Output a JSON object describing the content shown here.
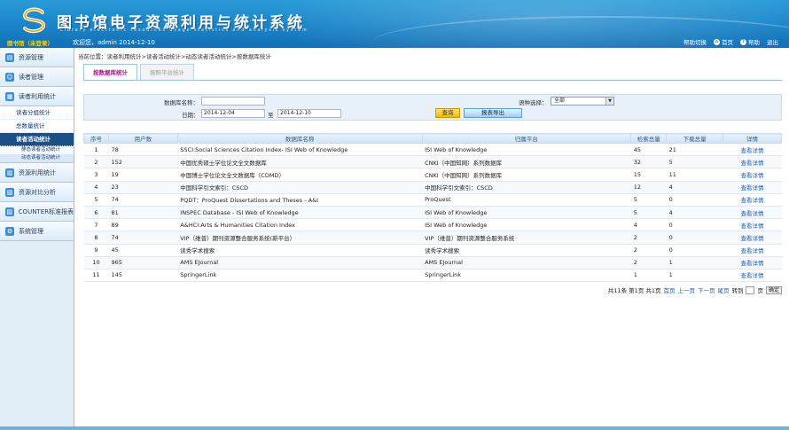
{
  "header": {
    "title": "图书馆电子资源利用与统计系统",
    "subtitle": "Library electronic resources usage statistics and analysis system",
    "user_role": "图书馆（未登录）",
    "welcome": "欢迎您，admin  2014-12-10",
    "links": {
      "switch": "帮助切换",
      "home": "首页",
      "help": "帮助",
      "logout": "退出"
    }
  },
  "sidebar": {
    "items": [
      {
        "label": "资源管理"
      },
      {
        "label": "读者管理"
      },
      {
        "label": "读者利用统计"
      },
      {
        "label": "资源利用统计"
      },
      {
        "label": "资源对比分析"
      },
      {
        "label": "COUNTER标准报表"
      },
      {
        "label": "系统管理"
      }
    ],
    "sub_items": [
      {
        "label": "读者分组统计"
      },
      {
        "label": "总数量统计"
      },
      {
        "label": "读者活动统计"
      }
    ],
    "subsub_items": [
      {
        "label": "静态读者活动统计"
      },
      {
        "label": "动态读者活动统计"
      }
    ]
  },
  "breadcrumb": "当前位置：读者利用统计>读者活动统计>动态读者活动统计>按数据库统计",
  "tabs": [
    {
      "label": "按数据库统计"
    },
    {
      "label": "按照平台统计"
    }
  ],
  "search": {
    "db_name_label": "数据库名称：",
    "db_name_value": "",
    "date_label": "日期：",
    "date_from": "2014-12-04",
    "date_to_label": "至",
    "date_to": "2014-12-10",
    "lang_label": "语种选择：",
    "lang_value": "全部",
    "query_button": "查询",
    "export_button": "报表导出"
  },
  "table": {
    "headers": [
      "序号",
      "用户数",
      "数据库名称",
      "归属平台",
      "检索总量",
      "下载总量",
      "详情"
    ],
    "rows": [
      [
        "1",
        "78",
        "SSCI:Social Sciences Citation Index- ISI Web of Knowledge",
        "ISI Web of Knowledge",
        "45",
        "21",
        "查看详情"
      ],
      [
        "2",
        "152",
        "中国优秀硕士学位论文全文数据库",
        "CNKI（中国知网）系列数据库",
        "32",
        "5",
        "查看详情"
      ],
      [
        "3",
        "19",
        "中国博士学位论文全文数据库（CDMD）",
        "CNKI（中国知网）系列数据库",
        "15",
        "11",
        "查看详情"
      ],
      [
        "4",
        "23",
        "中国科学引文索引：CSCD",
        "中国科学引文索引：CSCD",
        "12",
        "4",
        "查看详情"
      ],
      [
        "5",
        "74",
        "PQDT：ProQuest Dissertations and Theses - A&I",
        "ProQuest",
        "5",
        "0",
        "查看详情"
      ],
      [
        "6",
        "81",
        "INSPEC Database - ISI Web of Knowledge",
        "ISI Web of Knowledge",
        "5",
        "4",
        "查看详情"
      ],
      [
        "7",
        "89",
        "A&HCI:Arts & Humanities Citation Index",
        "ISI Web of Knowledge",
        "4",
        "0",
        "查看详情"
      ],
      [
        "8",
        "74",
        "VIP（维普）期刊资源整合服务系统(新平台）",
        "VIP（维普）期刊资源整合服务系统",
        "2",
        "0",
        "查看详情"
      ],
      [
        "9",
        "45",
        "读秀学术搜索",
        "读秀学术搜索",
        "2",
        "0",
        "查看详情"
      ],
      [
        "10",
        "965",
        "AMS EJournal",
        "AMS EJournal",
        "2",
        "1",
        "查看详情"
      ],
      [
        "11",
        "145",
        "SpringerLink",
        "SpringerLink",
        "1",
        "1",
        "查看详情"
      ]
    ]
  },
  "pager": {
    "summary": "共11条 第1页 共1页",
    "first": "首页",
    "prev": "上一页",
    "next": "下一页",
    "last": "尾页",
    "goto_label": "转到",
    "page_label": "页",
    "confirm": "确定"
  },
  "colors": {
    "header": "#1a84c8",
    "active_tab_text": "#a0178d",
    "link": "#1b5fb0",
    "active_nav": "#1c4f86"
  }
}
